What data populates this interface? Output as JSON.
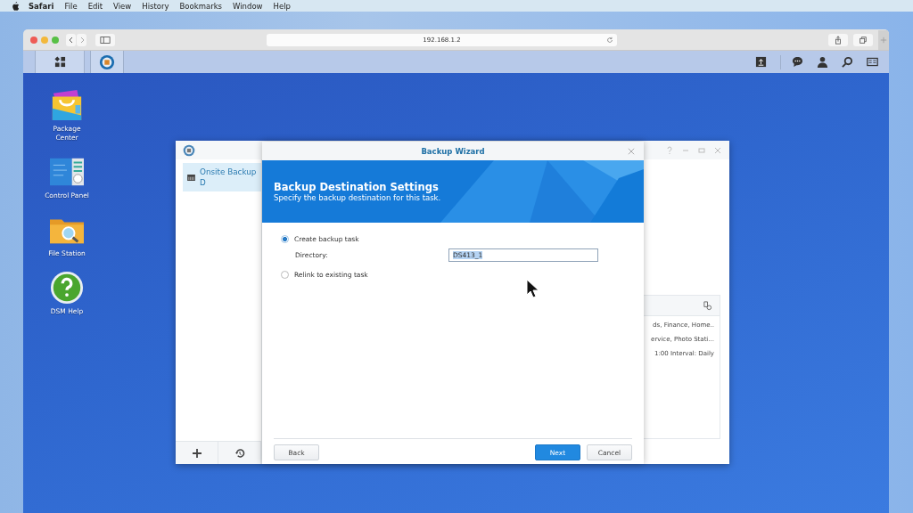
{
  "menu_bar": {
    "app": "Safari",
    "items": [
      "File",
      "Edit",
      "View",
      "History",
      "Bookmarks",
      "Window",
      "Help"
    ]
  },
  "browser": {
    "address": "192.168.1.2"
  },
  "desktop_icons": [
    {
      "label": "Package Center",
      "kind": "package"
    },
    {
      "label": "Control Panel",
      "kind": "control"
    },
    {
      "label": "File Station",
      "kind": "files"
    },
    {
      "label": "DSM Help",
      "kind": "help"
    }
  ],
  "backup_window": {
    "tasks": [
      {
        "label": "Onsite Backup D",
        "selected": true
      }
    ],
    "rows": [
      "ds, Finance, Home..",
      "ervice, Photo Stati...",
      "1:00 Interval: Daily"
    ]
  },
  "wizard": {
    "title": "Backup Wizard",
    "heading": "Backup Destination Settings",
    "subheading": "Specify the backup destination for this task.",
    "options": [
      {
        "label": "Create backup task",
        "selected": true
      },
      {
        "label": "Relink to existing task",
        "selected": false
      }
    ],
    "directory": {
      "label": "Directory:",
      "value": "DS413_1",
      "selected": true
    },
    "buttons": [
      {
        "label": "Back",
        "kind": "secondary"
      },
      {
        "label": "Next",
        "kind": "primary"
      },
      {
        "label": "Cancel",
        "kind": "secondary"
      }
    ]
  }
}
